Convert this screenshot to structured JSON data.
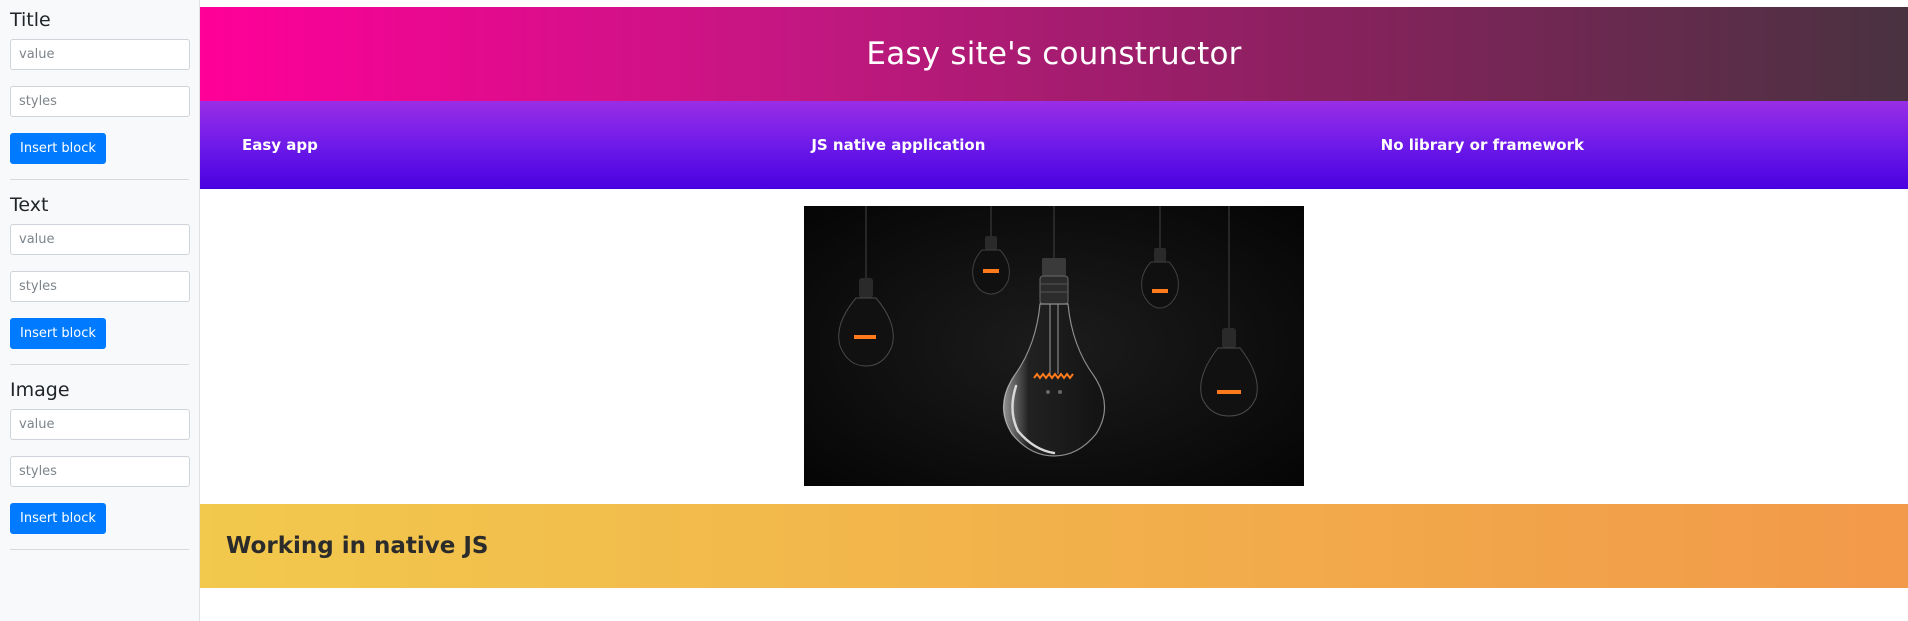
{
  "sidebar": {
    "panels": [
      {
        "title": "Title",
        "value_placeholder": "value",
        "styles_placeholder": "styles",
        "button_label": "Insert block"
      },
      {
        "title": "Text",
        "value_placeholder": "value",
        "styles_placeholder": "styles",
        "button_label": "Insert block"
      },
      {
        "title": "Image",
        "value_placeholder": "value",
        "styles_placeholder": "styles",
        "button_label": "Insert block"
      }
    ]
  },
  "main": {
    "title": "Easy site's counstructor",
    "columns": [
      "Easy app",
      "JS native application",
      "No library or framework"
    ],
    "image_icon": "hanging-light-bulbs-image",
    "text": "Working in native JS"
  },
  "colors": {
    "primary_button": "#007bff",
    "title_gradient": [
      "#ff0099",
      "#493240"
    ],
    "columns_gradient": [
      "#9a2ee6",
      "#4a00e0"
    ],
    "text_gradient": [
      "#f2c94c",
      "#f2994a"
    ]
  }
}
